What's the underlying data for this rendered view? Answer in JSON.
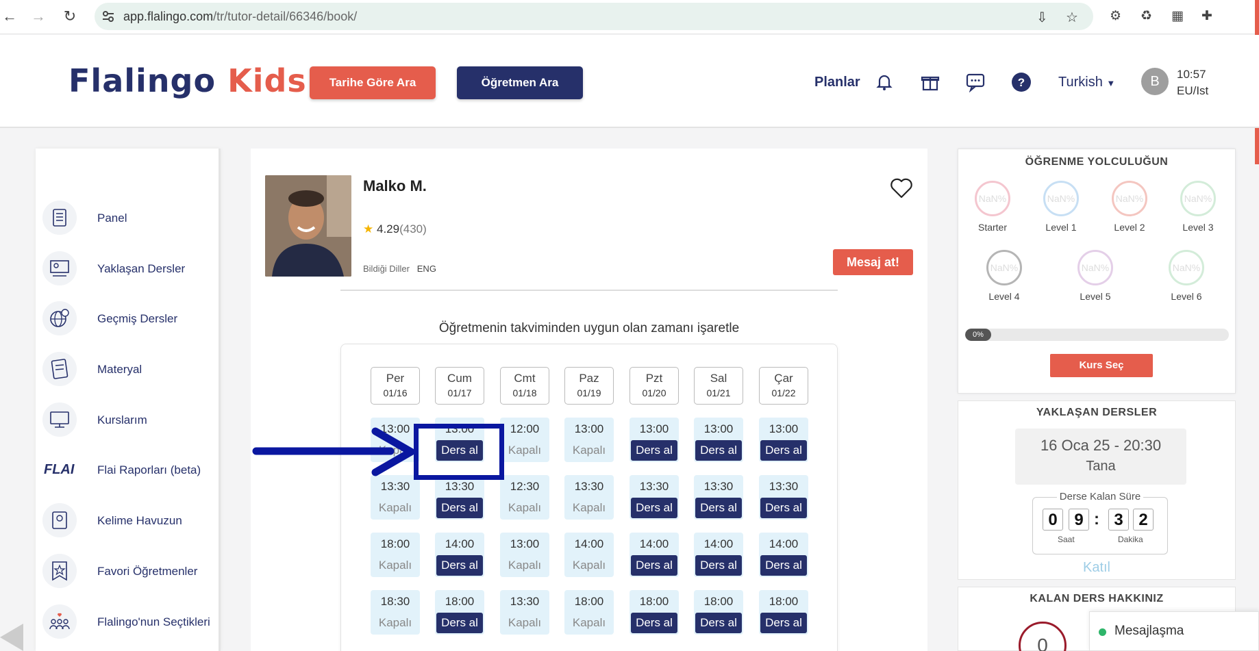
{
  "browser": {
    "url_host": "app.flalingo.com",
    "url_path": "/tr/tutor-detail/66346/book/"
  },
  "header": {
    "logo_part1": "Flalingo",
    "logo_part2": "Kids",
    "search_by_date": "Tarihe Göre Ara",
    "search_teacher": "Öğretmen Ara",
    "plans": "Planlar",
    "language": "Turkish",
    "avatar_initial": "B",
    "time": "10:57",
    "timezone": "EU/Ist"
  },
  "sidebar": {
    "items": [
      {
        "label": "Panel"
      },
      {
        "label": "Yaklaşan Dersler"
      },
      {
        "label": "Geçmiş Dersler"
      },
      {
        "label": "Materyal"
      },
      {
        "label": "Kurslarım"
      },
      {
        "label": "Flai Raporları (beta)",
        "logo": "FLAI"
      },
      {
        "label": "Kelime Havuzun"
      },
      {
        "label": "Favori Öğretmenler"
      },
      {
        "label": "Flalingo'nun Seçtikleri"
      }
    ]
  },
  "tutor": {
    "name": "Malko M.",
    "rating": "4.29",
    "rating_count": "(430)",
    "languages_label": "Bildiği Diller",
    "languages": "ENG",
    "message_button": "Mesaj at!"
  },
  "calendar": {
    "heading": "Öğretmenin takviminden uygun olan zamanı işaretle",
    "days": [
      {
        "name": "Per",
        "date": "01/16",
        "slots": [
          [
            "13:00",
            "Kapalı"
          ],
          [
            "13:30",
            "Kapalı"
          ],
          [
            "18:00",
            "Kapalı"
          ],
          [
            "18:30",
            "Kapalı"
          ]
        ]
      },
      {
        "name": "Cum",
        "date": "01/17",
        "slots": [
          [
            "13:00",
            "Ders al"
          ],
          [
            "13:30",
            "Ders al"
          ],
          [
            "14:00",
            "Ders al"
          ],
          [
            "18:00",
            "Ders al"
          ]
        ]
      },
      {
        "name": "Cmt",
        "date": "01/18",
        "slots": [
          [
            "12:00",
            "Kapalı"
          ],
          [
            "12:30",
            "Kapalı"
          ],
          [
            "13:00",
            "Kapalı"
          ],
          [
            "13:30",
            "Kapalı"
          ]
        ]
      },
      {
        "name": "Paz",
        "date": "01/19",
        "slots": [
          [
            "13:00",
            "Kapalı"
          ],
          [
            "13:30",
            "Kapalı"
          ],
          [
            "14:00",
            "Kapalı"
          ],
          [
            "18:00",
            "Kapalı"
          ]
        ]
      },
      {
        "name": "Pzt",
        "date": "01/20",
        "slots": [
          [
            "13:00",
            "Ders al"
          ],
          [
            "13:30",
            "Ders al"
          ],
          [
            "14:00",
            "Ders al"
          ],
          [
            "18:00",
            "Ders al"
          ]
        ]
      },
      {
        "name": "Sal",
        "date": "01/21",
        "slots": [
          [
            "13:00",
            "Ders al"
          ],
          [
            "13:30",
            "Ders al"
          ],
          [
            "14:00",
            "Ders al"
          ],
          [
            "18:00",
            "Ders al"
          ]
        ]
      },
      {
        "name": "Çar",
        "date": "01/22",
        "slots": [
          [
            "13:00",
            "Ders al"
          ],
          [
            "13:30",
            "Ders al"
          ],
          [
            "14:00",
            "Ders al"
          ],
          [
            "18:00",
            "Ders al"
          ]
        ]
      }
    ]
  },
  "journey": {
    "title": "ÖĞRENME YOLCULUĞUN",
    "levels": [
      {
        "label": "Starter",
        "value": "NaN%",
        "color": "#f4c6cf"
      },
      {
        "label": "Level 1",
        "value": "NaN%",
        "color": "#c7dff4"
      },
      {
        "label": "Level 2",
        "value": "NaN%",
        "color": "#f4c6c0"
      },
      {
        "label": "Level 3",
        "value": "NaN%",
        "color": "#d3ecd9"
      },
      {
        "label": "Level 4",
        "value": "NaN%",
        "color": "#b5b5b5"
      },
      {
        "label": "Level 5",
        "value": "NaN%",
        "color": "#e4cfe8"
      },
      {
        "label": "Level 6",
        "value": "NaN%",
        "color": "#d3ecd9"
      }
    ],
    "progress": 0,
    "progress_label": "0%",
    "course_button": "Kurs Seç"
  },
  "upcoming": {
    "title": "YAKLAŞAN DERSLER",
    "date": "16 Oca 25 - 20:30",
    "name": "Tana",
    "countdown_label": "Derse Kalan Süre",
    "digits": [
      "0",
      "9",
      "3",
      "2"
    ],
    "hours_label": "Saat",
    "minutes_label": "Dakika",
    "join": "Katıl"
  },
  "remaining": {
    "title": "KALAN DERS HAKKINIZ",
    "value": "0"
  },
  "chat": {
    "label": "Mesajlaşma"
  },
  "colors": {
    "accent_red": "#e55d4c",
    "navy": "#26306a",
    "annotation": "#0a17a0"
  }
}
